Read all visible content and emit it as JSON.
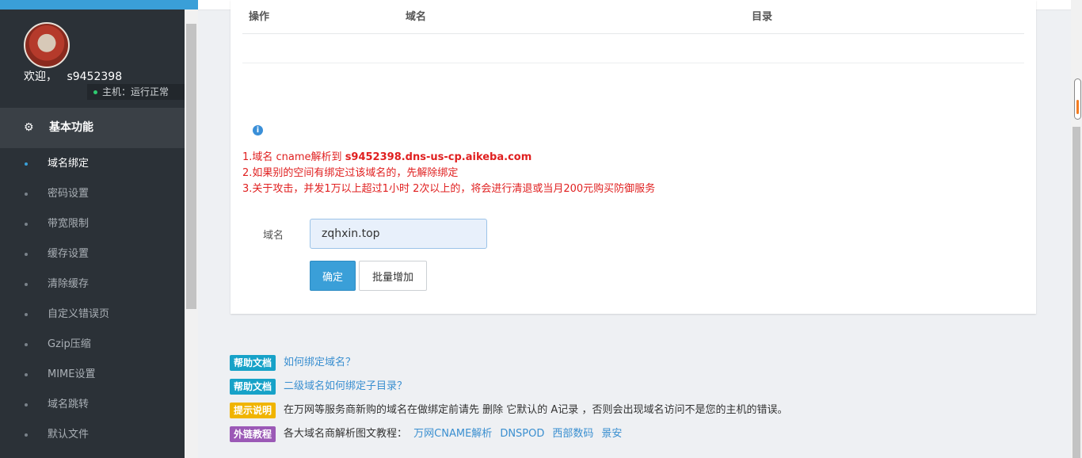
{
  "sidebar": {
    "welcome_label": "欢迎，",
    "username": "s9452398",
    "host_status": "主机：运行正常",
    "section_title": "基本功能",
    "items": [
      {
        "label": "域名绑定"
      },
      {
        "label": "密码设置"
      },
      {
        "label": "带宽限制"
      },
      {
        "label": "缓存设置"
      },
      {
        "label": "清除缓存"
      },
      {
        "label": "自定义错误页"
      },
      {
        "label": "Gzip压缩"
      },
      {
        "label": "MIME设置"
      },
      {
        "label": "域名跳转"
      },
      {
        "label": "默认文件"
      }
    ]
  },
  "table": {
    "columns": [
      "操作",
      "域名",
      "目录"
    ]
  },
  "notice": {
    "line1_prefix": "1.域名 cname解析到 ",
    "line1_host": "s9452398.dns-us-cp.aikeba.com",
    "line2": "2.如果别的空间有绑定过该域名的，先解除绑定",
    "line3": "3.关于攻击，并发1万以上超过1小时 2次以上的，将会进行清退或当月200元购买防御服务"
  },
  "form": {
    "domain_label": "域名",
    "domain_value": "zqhxin.top",
    "confirm_label": "确定",
    "batch_label": "批量增加"
  },
  "help": [
    {
      "tag": "帮助文档",
      "tag_color": "#17a2c8",
      "text": "如何绑定域名？"
    },
    {
      "tag": "帮助文档",
      "tag_color": "#17a2c8",
      "text": "二级域名如何绑定子目录？"
    },
    {
      "tag": "提示说明",
      "tag_color": "#f0b400",
      "text": "在万网等服务商新购的域名在做绑定前请先 删除 它默认的 A记录 ，否则会出现域名访问不是您的主机的错误。"
    },
    {
      "tag": "外链教程",
      "tag_color": "#9b59b6",
      "text": "各大域名商解析图文教程：",
      "links": [
        "万网CNAME解析",
        "DNSPOD",
        "西部数码",
        "景安"
      ]
    }
  ],
  "colors": {
    "accent": "#3a9fd8",
    "notice_red": "#e02020",
    "sidebar_bg": "#2b3137"
  }
}
